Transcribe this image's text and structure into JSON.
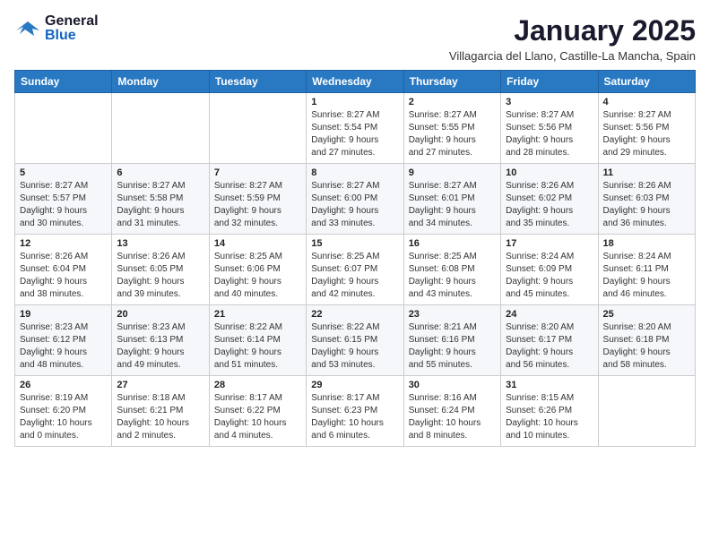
{
  "header": {
    "logo_general": "General",
    "logo_blue": "Blue",
    "month": "January 2025",
    "location": "Villagarcia del Llano, Castille-La Mancha, Spain"
  },
  "weekdays": [
    "Sunday",
    "Monday",
    "Tuesday",
    "Wednesday",
    "Thursday",
    "Friday",
    "Saturday"
  ],
  "weeks": [
    [
      {
        "day": "",
        "content": ""
      },
      {
        "day": "",
        "content": ""
      },
      {
        "day": "",
        "content": ""
      },
      {
        "day": "1",
        "content": "Sunrise: 8:27 AM\nSunset: 5:54 PM\nDaylight: 9 hours\nand 27 minutes."
      },
      {
        "day": "2",
        "content": "Sunrise: 8:27 AM\nSunset: 5:55 PM\nDaylight: 9 hours\nand 27 minutes."
      },
      {
        "day": "3",
        "content": "Sunrise: 8:27 AM\nSunset: 5:56 PM\nDaylight: 9 hours\nand 28 minutes."
      },
      {
        "day": "4",
        "content": "Sunrise: 8:27 AM\nSunset: 5:56 PM\nDaylight: 9 hours\nand 29 minutes."
      }
    ],
    [
      {
        "day": "5",
        "content": "Sunrise: 8:27 AM\nSunset: 5:57 PM\nDaylight: 9 hours\nand 30 minutes."
      },
      {
        "day": "6",
        "content": "Sunrise: 8:27 AM\nSunset: 5:58 PM\nDaylight: 9 hours\nand 31 minutes."
      },
      {
        "day": "7",
        "content": "Sunrise: 8:27 AM\nSunset: 5:59 PM\nDaylight: 9 hours\nand 32 minutes."
      },
      {
        "day": "8",
        "content": "Sunrise: 8:27 AM\nSunset: 6:00 PM\nDaylight: 9 hours\nand 33 minutes."
      },
      {
        "day": "9",
        "content": "Sunrise: 8:27 AM\nSunset: 6:01 PM\nDaylight: 9 hours\nand 34 minutes."
      },
      {
        "day": "10",
        "content": "Sunrise: 8:26 AM\nSunset: 6:02 PM\nDaylight: 9 hours\nand 35 minutes."
      },
      {
        "day": "11",
        "content": "Sunrise: 8:26 AM\nSunset: 6:03 PM\nDaylight: 9 hours\nand 36 minutes."
      }
    ],
    [
      {
        "day": "12",
        "content": "Sunrise: 8:26 AM\nSunset: 6:04 PM\nDaylight: 9 hours\nand 38 minutes."
      },
      {
        "day": "13",
        "content": "Sunrise: 8:26 AM\nSunset: 6:05 PM\nDaylight: 9 hours\nand 39 minutes."
      },
      {
        "day": "14",
        "content": "Sunrise: 8:25 AM\nSunset: 6:06 PM\nDaylight: 9 hours\nand 40 minutes."
      },
      {
        "day": "15",
        "content": "Sunrise: 8:25 AM\nSunset: 6:07 PM\nDaylight: 9 hours\nand 42 minutes."
      },
      {
        "day": "16",
        "content": "Sunrise: 8:25 AM\nSunset: 6:08 PM\nDaylight: 9 hours\nand 43 minutes."
      },
      {
        "day": "17",
        "content": "Sunrise: 8:24 AM\nSunset: 6:09 PM\nDaylight: 9 hours\nand 45 minutes."
      },
      {
        "day": "18",
        "content": "Sunrise: 8:24 AM\nSunset: 6:11 PM\nDaylight: 9 hours\nand 46 minutes."
      }
    ],
    [
      {
        "day": "19",
        "content": "Sunrise: 8:23 AM\nSunset: 6:12 PM\nDaylight: 9 hours\nand 48 minutes."
      },
      {
        "day": "20",
        "content": "Sunrise: 8:23 AM\nSunset: 6:13 PM\nDaylight: 9 hours\nand 49 minutes."
      },
      {
        "day": "21",
        "content": "Sunrise: 8:22 AM\nSunset: 6:14 PM\nDaylight: 9 hours\nand 51 minutes."
      },
      {
        "day": "22",
        "content": "Sunrise: 8:22 AM\nSunset: 6:15 PM\nDaylight: 9 hours\nand 53 minutes."
      },
      {
        "day": "23",
        "content": "Sunrise: 8:21 AM\nSunset: 6:16 PM\nDaylight: 9 hours\nand 55 minutes."
      },
      {
        "day": "24",
        "content": "Sunrise: 8:20 AM\nSunset: 6:17 PM\nDaylight: 9 hours\nand 56 minutes."
      },
      {
        "day": "25",
        "content": "Sunrise: 8:20 AM\nSunset: 6:18 PM\nDaylight: 9 hours\nand 58 minutes."
      }
    ],
    [
      {
        "day": "26",
        "content": "Sunrise: 8:19 AM\nSunset: 6:20 PM\nDaylight: 10 hours\nand 0 minutes."
      },
      {
        "day": "27",
        "content": "Sunrise: 8:18 AM\nSunset: 6:21 PM\nDaylight: 10 hours\nand 2 minutes."
      },
      {
        "day": "28",
        "content": "Sunrise: 8:17 AM\nSunset: 6:22 PM\nDaylight: 10 hours\nand 4 minutes."
      },
      {
        "day": "29",
        "content": "Sunrise: 8:17 AM\nSunset: 6:23 PM\nDaylight: 10 hours\nand 6 minutes."
      },
      {
        "day": "30",
        "content": "Sunrise: 8:16 AM\nSunset: 6:24 PM\nDaylight: 10 hours\nand 8 minutes."
      },
      {
        "day": "31",
        "content": "Sunrise: 8:15 AM\nSunset: 6:26 PM\nDaylight: 10 hours\nand 10 minutes."
      },
      {
        "day": "",
        "content": ""
      }
    ]
  ]
}
